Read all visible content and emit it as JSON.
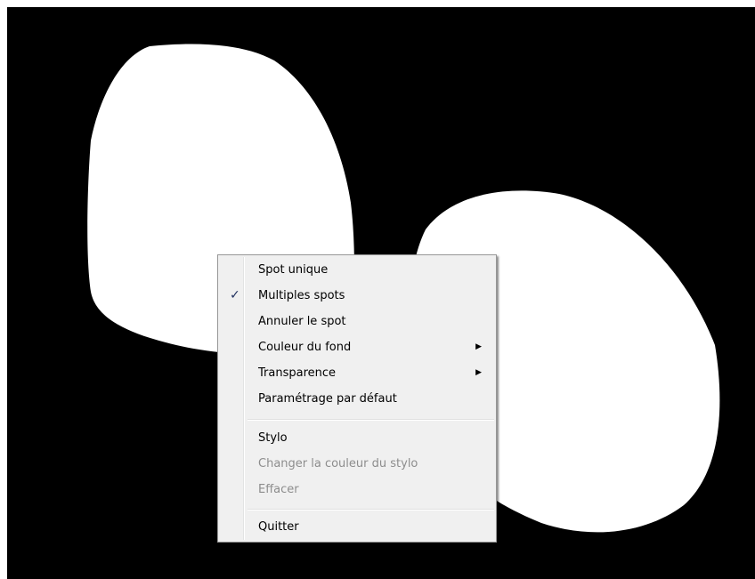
{
  "desktop": {
    "background_color": "#000000",
    "spot_color": "#ffffff"
  },
  "context_menu": {
    "items": [
      {
        "label": "Spot unique",
        "checked": false,
        "submenu": false,
        "disabled": false
      },
      {
        "label": "Multiples spots",
        "checked": true,
        "submenu": false,
        "disabled": false
      },
      {
        "label": "Annuler le spot",
        "checked": false,
        "submenu": false,
        "disabled": false
      },
      {
        "label": "Couleur du fond",
        "checked": false,
        "submenu": true,
        "disabled": false
      },
      {
        "label": "Transparence",
        "checked": false,
        "submenu": true,
        "disabled": false
      },
      {
        "label": "Paramétrage par défaut",
        "checked": false,
        "submenu": false,
        "disabled": false
      },
      {
        "label": "Stylo",
        "checked": false,
        "submenu": false,
        "disabled": false
      },
      {
        "label": "Changer la couleur du stylo",
        "checked": false,
        "submenu": false,
        "disabled": true
      },
      {
        "label": "Effacer",
        "checked": false,
        "submenu": false,
        "disabled": true
      },
      {
        "label": "Quitter",
        "checked": false,
        "submenu": false,
        "disabled": false
      }
    ],
    "check_glyph": "✓",
    "submenu_glyph": "▶"
  }
}
